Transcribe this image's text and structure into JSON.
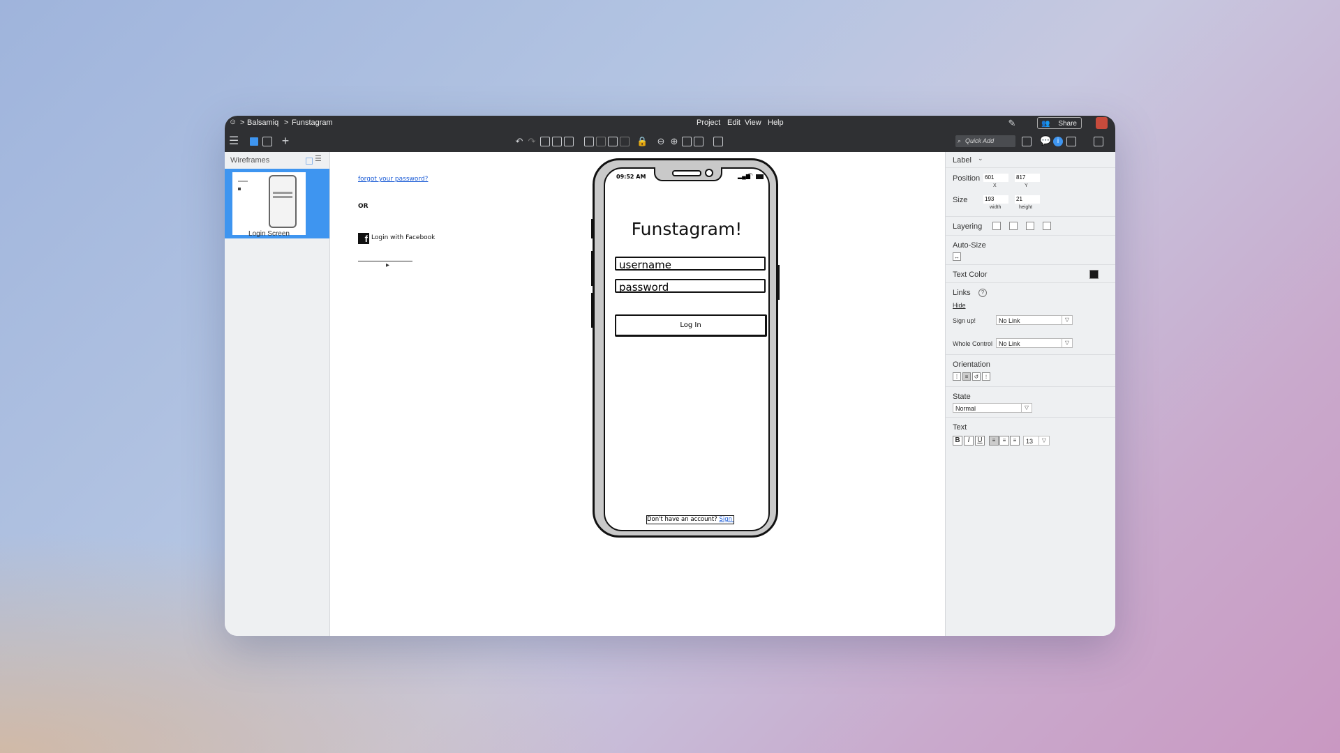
{
  "app": {
    "breadcrumb": [
      "Balsamiq",
      "Funstagram"
    ],
    "menu": [
      "Project",
      "Edit",
      "View",
      "Help"
    ],
    "share_label": "Share",
    "quick_add_placeholder": "Quick Add"
  },
  "left_panel": {
    "title": "Wireframes",
    "wireframes": [
      {
        "label": "Login Screen",
        "selected": true
      }
    ]
  },
  "canvas": {
    "forgot_password": "forgot your password?",
    "or_text": "OR",
    "facebook_login": "Login with Facebook",
    "phone": {
      "time": "09:52 AM",
      "app_title": "Funstagram!",
      "username_value": "username",
      "password_value": "password",
      "login_label": "Log In",
      "signup_prompt": "Don't have an account?",
      "signup_link": "Sign up"
    }
  },
  "inspector": {
    "control_type": "Label",
    "position_label": "Position",
    "position": {
      "x": "601",
      "y": "817",
      "x_caption": "X",
      "y_caption": "Y"
    },
    "size_label": "Size",
    "size": {
      "width": "193",
      "height": "21",
      "width_caption": "width",
      "height_caption": "height"
    },
    "layering_label": "Layering",
    "autosize_label": "Auto-Size",
    "text_color_label": "Text Color",
    "text_color": "#1a1a1a",
    "links_label": "Links",
    "hide_label": "Hide",
    "links": [
      {
        "name": "Sign up!",
        "value": "No Link"
      },
      {
        "name": "Whole Control",
        "value": "No Link"
      }
    ],
    "orientation_label": "Orientation",
    "state_label": "State",
    "state_value": "Normal",
    "text_label": "Text",
    "font_size": "13"
  },
  "colors": {
    "selection_blue": "#3e95f0",
    "link_blue": "#1a5bd6",
    "toolbar_dark": "#2f3033"
  }
}
